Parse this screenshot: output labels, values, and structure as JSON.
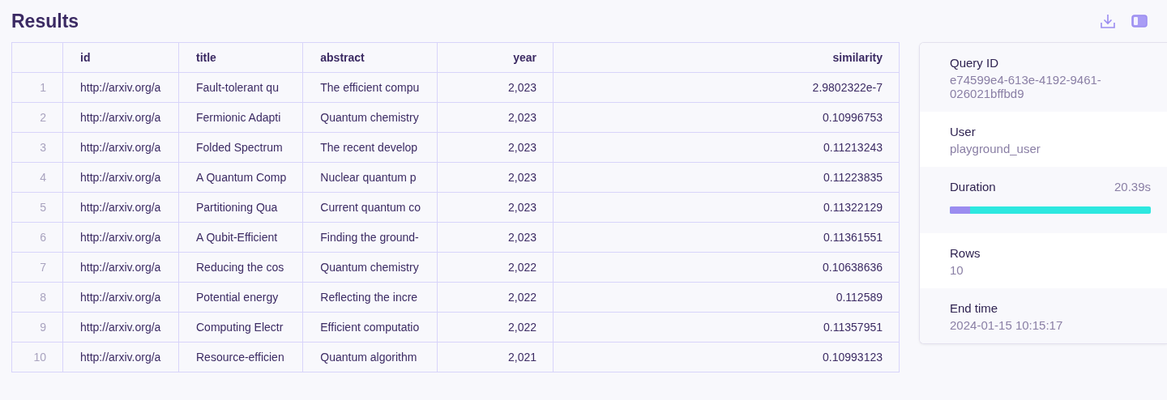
{
  "heading": "Results",
  "table": {
    "columns": [
      "id",
      "title",
      "abstract",
      "year",
      "similarity"
    ],
    "rows": [
      {
        "index": "1",
        "cells": [
          "http://arxiv.org/a",
          "Fault-tolerant qu",
          "The efficient compu",
          "2,023",
          "2.9802322e-7"
        ]
      },
      {
        "index": "2",
        "cells": [
          "http://arxiv.org/a",
          "Fermionic Adapti",
          "Quantum chemistry",
          "2,023",
          "0.10996753"
        ]
      },
      {
        "index": "3",
        "cells": [
          "http://arxiv.org/a",
          "Folded Spectrum",
          "The recent develop",
          "2,023",
          "0.11213243"
        ]
      },
      {
        "index": "4",
        "cells": [
          "http://arxiv.org/a",
          "A Quantum Comp",
          "Nuclear quantum p",
          "2,023",
          "0.11223835"
        ]
      },
      {
        "index": "5",
        "cells": [
          "http://arxiv.org/a",
          "Partitioning Qua",
          "Current quantum co",
          "2,023",
          "0.11322129"
        ]
      },
      {
        "index": "6",
        "cells": [
          "http://arxiv.org/a",
          "A Qubit-Efficient",
          "Finding the ground-",
          "2,023",
          "0.11361551"
        ]
      },
      {
        "index": "7",
        "cells": [
          "http://arxiv.org/a",
          "Reducing the cos",
          "Quantum chemistry",
          "2,022",
          "0.10638636"
        ]
      },
      {
        "index": "8",
        "cells": [
          "http://arxiv.org/a",
          "Potential energy",
          "Reflecting the incre",
          "2,022",
          "0.112589"
        ]
      },
      {
        "index": "9",
        "cells": [
          "http://arxiv.org/a",
          "Computing Electr",
          "Efficient computatio",
          "2,022",
          "0.11357951"
        ]
      },
      {
        "index": "10",
        "cells": [
          "http://arxiv.org/a",
          "Resource-efficien",
          "Quantum algorithm",
          "2,021",
          "0.10993123"
        ]
      }
    ]
  },
  "details": [
    {
      "kind": "text",
      "label": "Query ID",
      "value": "e74599e4-613e-4192-9461-026021bffbd9"
    },
    {
      "kind": "text",
      "label": "User",
      "value": "playground_user"
    },
    {
      "kind": "bar",
      "label": "Duration",
      "value": "20.39s",
      "level": 0.1
    },
    {
      "kind": "text",
      "label": "Rows",
      "value": "10"
    },
    {
      "kind": "text",
      "label": "End time",
      "value": "2024-01-15 10:15:17"
    }
  ]
}
